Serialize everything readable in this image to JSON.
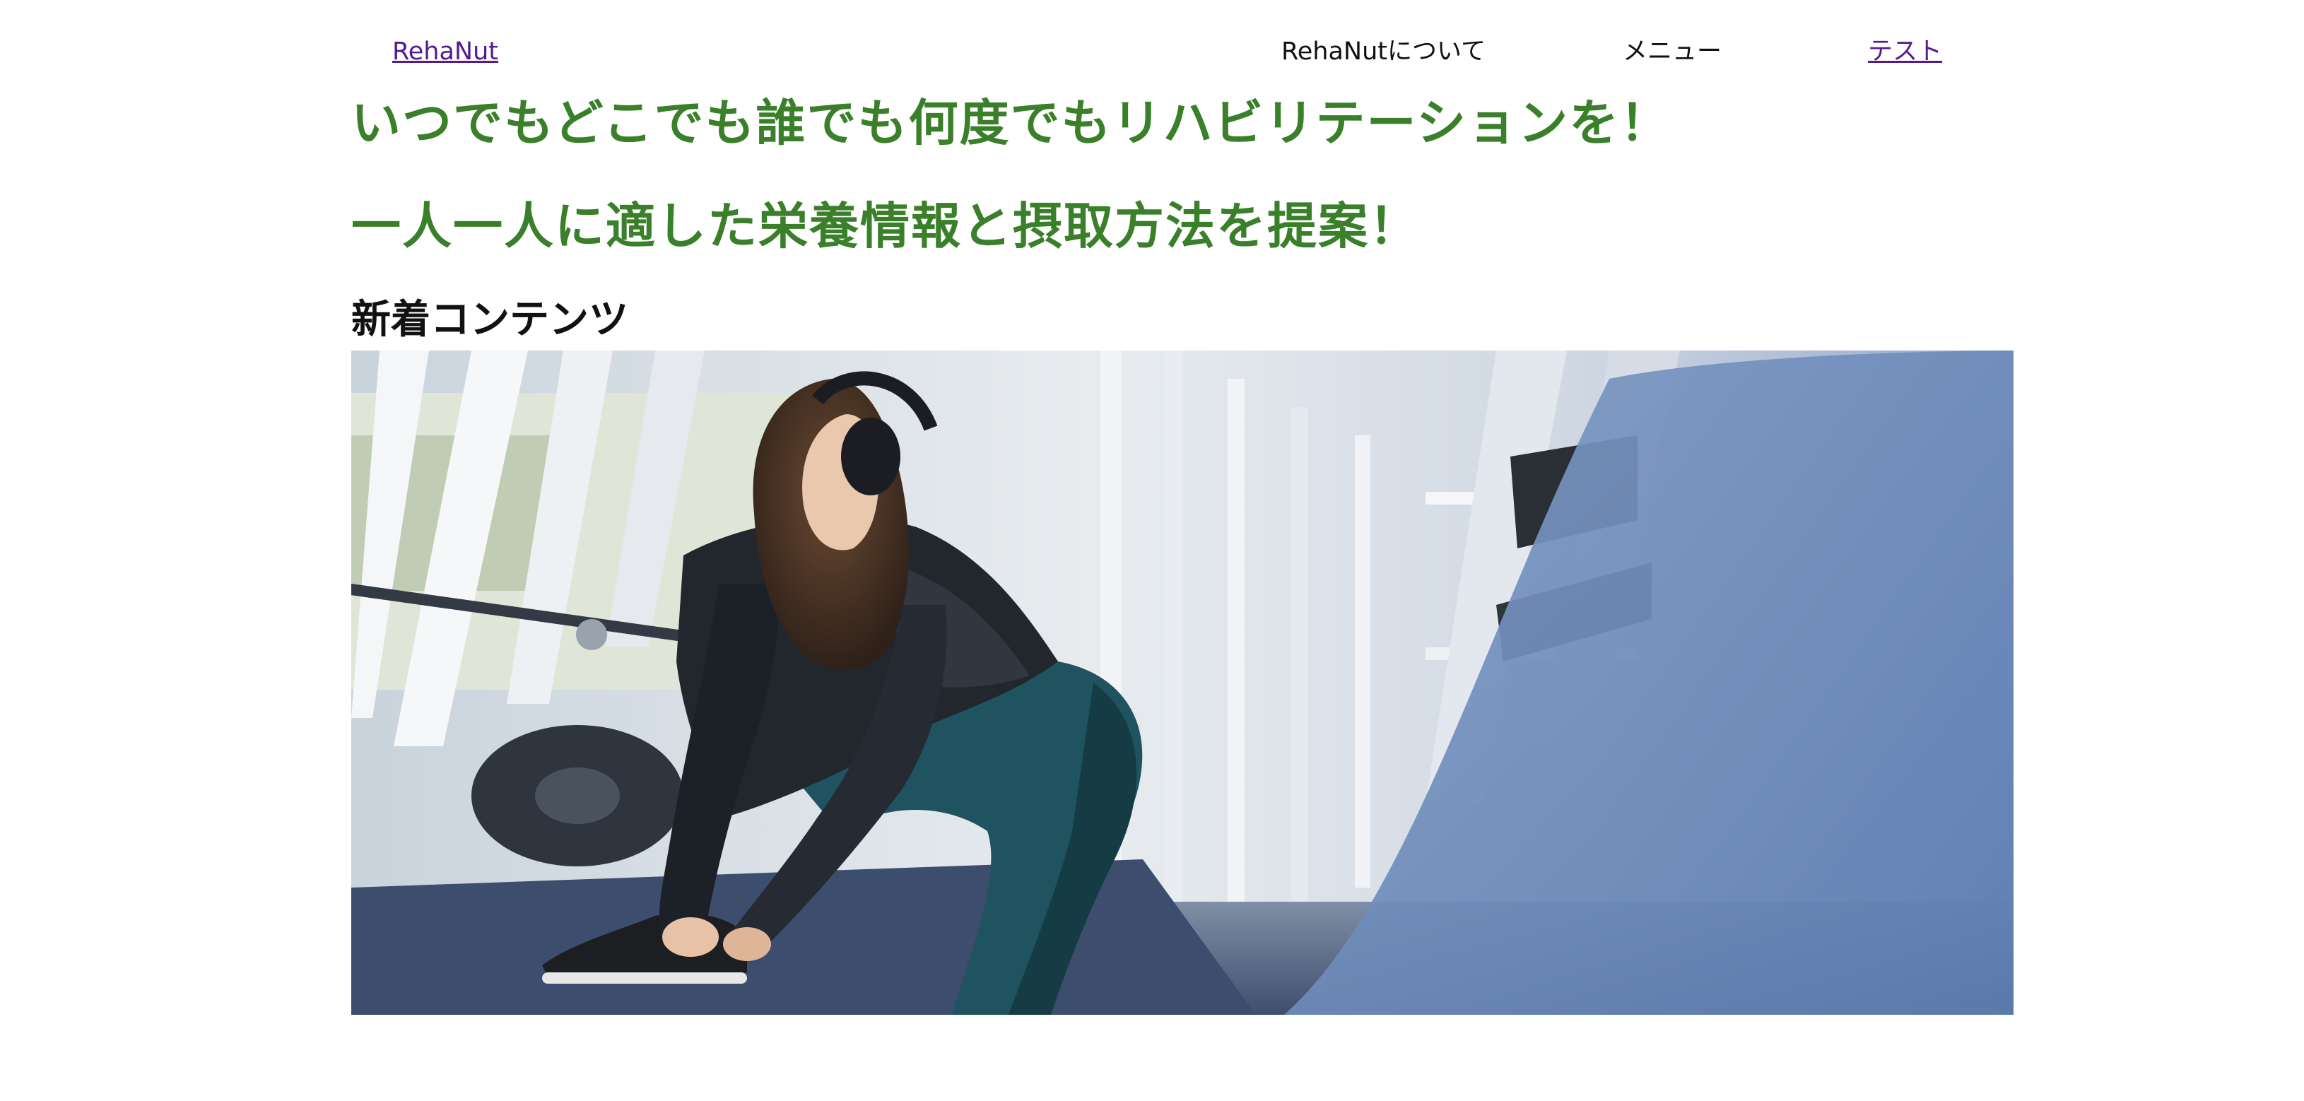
{
  "nav": {
    "logo": "RehaNut",
    "about": "RehaNutについて",
    "menu": "メニュー",
    "test": "テスト"
  },
  "hero_text": {
    "headline_1": "いつでもどこでも誰でも何度でもリハビリテーションを！",
    "headline_2": "一人一人に適した栄養情報と摂取方法を提案！"
  },
  "new_contents": {
    "title": "新着コンテンツ",
    "image_alt": "ジムでシューズの紐を結ぶヘッドホンの女性"
  },
  "colors": {
    "headline": "#3a7f29",
    "link_visited": "#551a8b"
  },
  "icons": {
    "hero_image": "fitness-photo"
  }
}
